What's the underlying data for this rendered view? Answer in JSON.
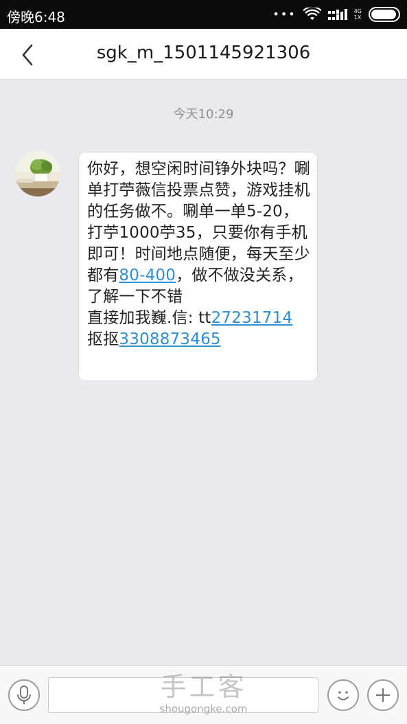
{
  "status_bar": {
    "time": "傍晚6:48",
    "network_top": "4G",
    "network_bottom": "1X",
    "battery_level": 0.95
  },
  "header": {
    "back_icon": "chevron-left-icon",
    "title": "sgk_m_1501145921306"
  },
  "conversation": {
    "timestamp": "今天10:29",
    "message": {
      "part1": "你好，想空闲时间铮外块吗？唰单打苧薇信投票点赞，游戏挂机的任务做不。唰单一单5-20，打苧1000苧35，只要你有手机即可！时间地点随便，每天至少都有",
      "link1": "80-400",
      "part2": "，做不做没关系，了解一下不错",
      "part3": "直接加我巍.信: tt",
      "link2": "27231714",
      "part4": "抠抠",
      "link3": "3308873465"
    }
  },
  "input_bar": {
    "mic_icon": "microphone-icon",
    "input_value": "",
    "emoji_icon": "smiley-icon",
    "add_icon": "plus-icon"
  },
  "watermark": {
    "main": "手工客",
    "sub": "shougongke.com"
  }
}
